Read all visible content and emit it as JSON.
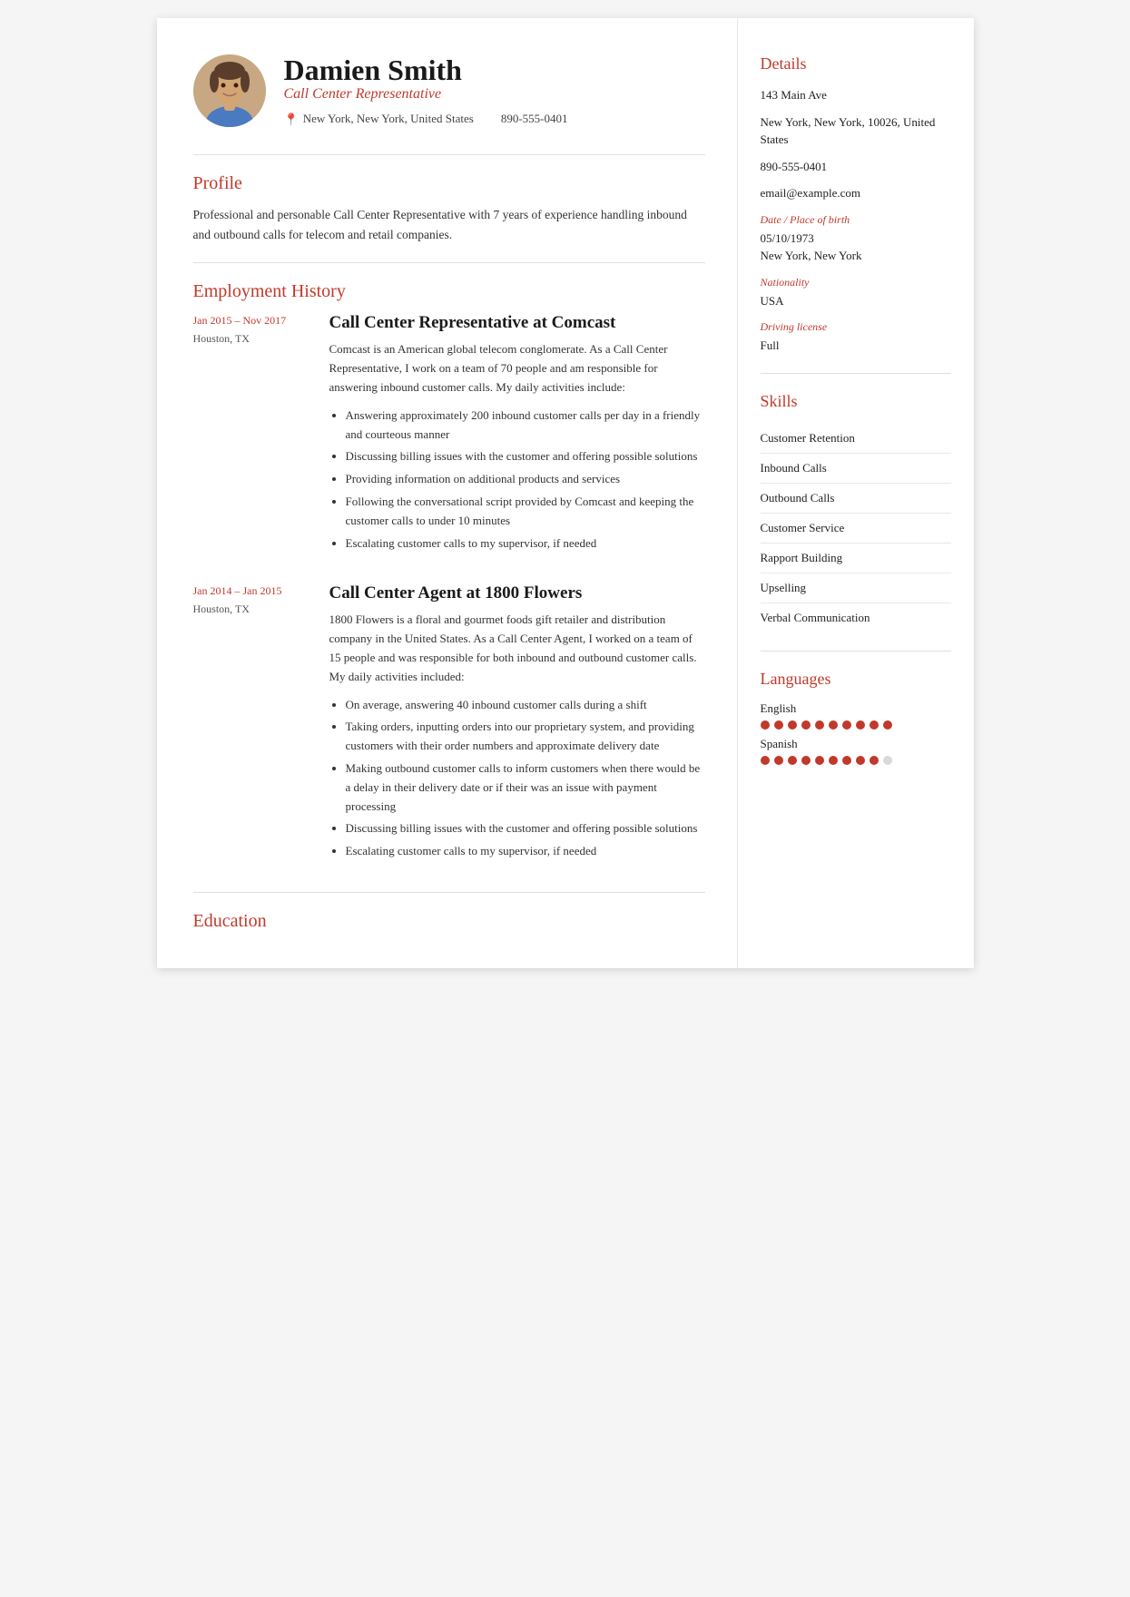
{
  "header": {
    "name": "Damien Smith",
    "job_title": "Call Center Representative",
    "location": "New York, New York, United States",
    "phone": "890-555-0401"
  },
  "profile": {
    "section_title": "Profile",
    "text": "Professional and personable Call Center Representative with 7 years of experience handling inbound and outbound calls for telecom and retail companies."
  },
  "employment": {
    "section_title": "Employment History",
    "jobs": [
      {
        "dates": "Jan 2015 – Nov 2017",
        "location": "Houston, TX",
        "title": "Call Center Representative at Comcast",
        "description": "Comcast is an American global telecom conglomerate. As a Call Center Representative, I work on a team of 70 people and am responsible for answering inbound customer calls. My daily activities include:",
        "bullets": [
          "Answering approximately 200 inbound customer calls per day in a friendly and courteous manner",
          "Discussing billing issues with the customer and offering possible solutions",
          "Providing information on additional products and services",
          "Following the conversational script provided by Comcast and keeping the customer calls to under 10 minutes",
          "Escalating customer calls to my supervisor, if needed"
        ]
      },
      {
        "dates": "Jan 2014 – Jan 2015",
        "location": "Houston, TX",
        "title": "Call Center Agent at 1800 Flowers",
        "description": "1800 Flowers is a floral and gourmet foods gift retailer and distribution company in the United States. As a Call Center Agent, I worked on a team of 15 people and was responsible for both inbound and outbound customer calls. My daily activities included:",
        "bullets": [
          "On average, answering 40 inbound customer calls during a shift",
          "Taking orders, inputting orders into our proprietary system, and providing customers with their order numbers and approximate delivery date",
          "Making outbound customer calls to inform customers when there would be a delay in their delivery date or if their was an issue with payment processing",
          "Discussing billing issues with the customer and offering possible solutions",
          "Escalating customer calls to my supervisor, if needed"
        ]
      }
    ]
  },
  "education": {
    "section_title": "Education"
  },
  "details": {
    "section_title": "Details",
    "address1": "143 Main Ave",
    "address2": "New York, New York, 10026, United States",
    "phone": "890-555-0401",
    "email": "email@example.com",
    "dob_label": "Date / Place of birth",
    "dob": "05/10/1973",
    "dob_place": "New York, New York",
    "nationality_label": "Nationality",
    "nationality": "USA",
    "driving_label": "Driving license",
    "driving": "Full"
  },
  "skills": {
    "section_title": "Skills",
    "items": [
      "Customer Retention",
      "Inbound Calls",
      "Outbound Calls",
      "Customer Service",
      "Rapport Building",
      "Upselling",
      "Verbal Communication"
    ]
  },
  "languages": {
    "section_title": "Languages",
    "items": [
      {
        "name": "English",
        "level": 10
      },
      {
        "name": "Spanish",
        "level": 9
      }
    ]
  }
}
